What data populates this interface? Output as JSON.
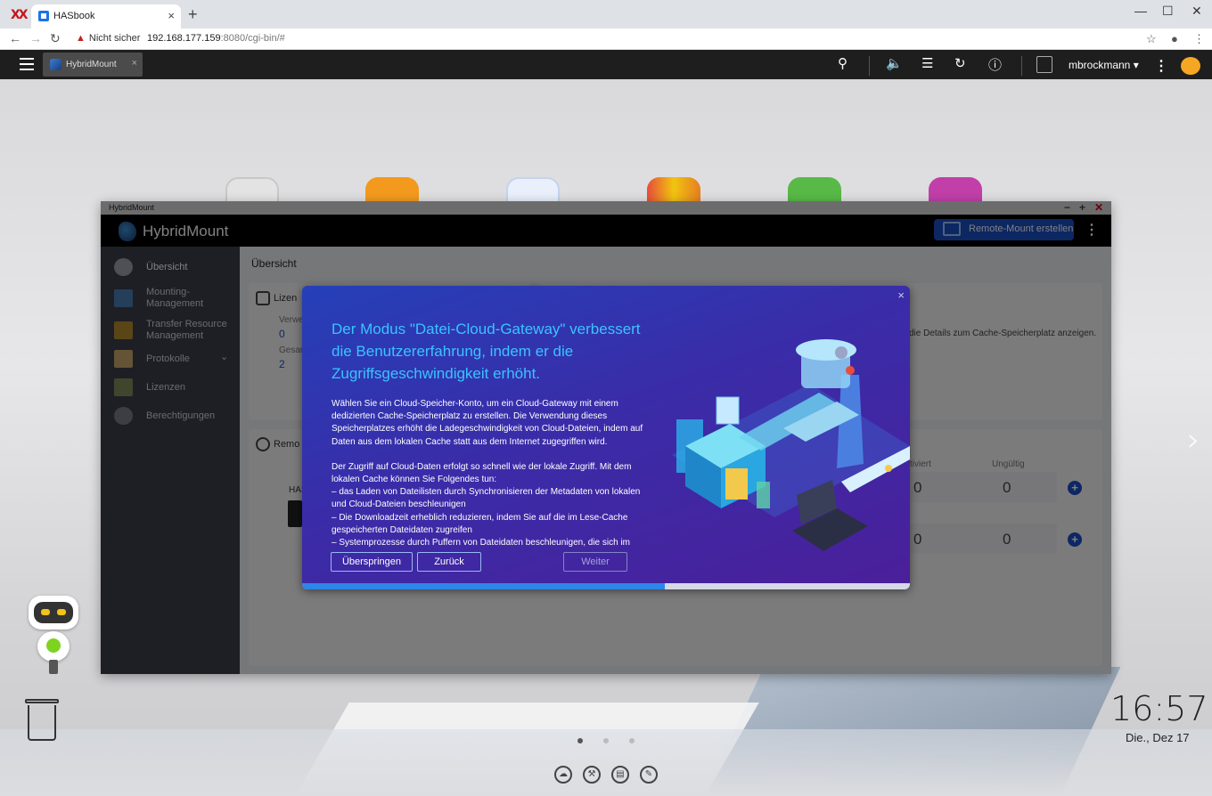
{
  "browser": {
    "logo": "XX",
    "tab_title": "HASbook",
    "tab_close": "×",
    "new_tab": "+",
    "security_label": "Nicht sicher",
    "url_host": "192.168.177.159",
    "url_rest": ":8080/cgi-bin/#",
    "win_min": "—",
    "win_max": "☐",
    "win_close": "✕"
  },
  "qts": {
    "app_tab_label": "HybridMount",
    "app_tab_close": "×",
    "username": "mbrockmann ▾",
    "kebab": "⋮",
    "icons": [
      "search-icon",
      "volume-icon",
      "stack-icon",
      "sync-icon",
      "info-icon",
      "user-icon",
      "dashboard-icon"
    ]
  },
  "window": {
    "titlebar": "HybridMount",
    "app_title": "HybridMount",
    "create_button": "Remote-Mount erstellen",
    "kebab": "⋮",
    "ctl_min": "−",
    "ctl_max": "+",
    "ctl_close": "✕"
  },
  "sidebar": {
    "items": [
      {
        "label": "Übersicht",
        "icon": "dashboard-icon"
      },
      {
        "label": "Mounting-\nManagement",
        "icon": "mounting-icon"
      },
      {
        "label": "Transfer Resource\nManagement",
        "icon": "transfer-icon"
      },
      {
        "label": "Protokolle",
        "icon": "log-icon",
        "chevron": "⌄"
      },
      {
        "label": "Lizenzen",
        "icon": "license-icon"
      },
      {
        "label": "Berechtigungen",
        "icon": "permission-icon"
      }
    ]
  },
  "content": {
    "title": "Übersicht",
    "license_card": {
      "header": "Lizen",
      "label1": "Verwe",
      "value1": "0",
      "label2": "Gesar",
      "value2": "2"
    },
    "cache_card": {
      "text": "die Details zum Cache-Speicherplatz anzeigen."
    },
    "remote_card": {
      "header": "Remo",
      "device_label": "HAS",
      "col_activated": "ktiviert",
      "col_invalid": "Ungültig",
      "row1": [
        "0",
        "0"
      ],
      "row2": [
        "0",
        "0"
      ]
    }
  },
  "modal": {
    "close": "×",
    "headline": "Der Modus \"Datei-Cloud-Gateway\" verbessert die Benutzererfahrung, indem er die Zugriffsgeschwindigkeit erhöht.",
    "paragraph1": "Wählen Sie ein Cloud-Speicher-Konto, um ein Cloud-Gateway mit einem dedizierten Cache-Speicherplatz zu erstellen. Die Verwendung dieses Speicherplatzes erhöht die Ladegeschwindigkeit von Cloud-Dateien, indem auf Daten aus dem lokalen Cache statt aus dem Internet zugegriffen wird.",
    "paragraph2_intro": "Der Zugriff auf Cloud-Daten erfolgt so schnell wie der lokale Zugriff. Mit dem lokalen Cache können Sie Folgendes tun:",
    "bullet1": "– das Laden von Dateilisten durch Synchronisieren der Metadaten von lokalen und Cloud-Dateien beschleunigen",
    "bullet2": "– Die Downloadzeit erheblich reduzieren, indem Sie auf die im Lese-Cache gespeicherten Dateidaten zugreifen",
    "bullet3": "– Systemprozesse durch Puffern von Dateidaten beschleunigen, die sich im",
    "btn_skip": "Überspringen",
    "btn_back": "Zurück",
    "btn_next": "Weiter",
    "progress_fraction": 0.597
  },
  "desktop": {
    "time": "16:57",
    "date": "Die., Dez 17",
    "page_dots": 3,
    "active_dot": 0,
    "next_arrow": "›",
    "dock_icons": [
      "cloud-icon",
      "tools-icon",
      "book-icon",
      "notes-icon"
    ]
  },
  "colors": {
    "accent": "#1a4ec7",
    "headline": "#3cc2ff",
    "progress": "#2d86e8"
  }
}
